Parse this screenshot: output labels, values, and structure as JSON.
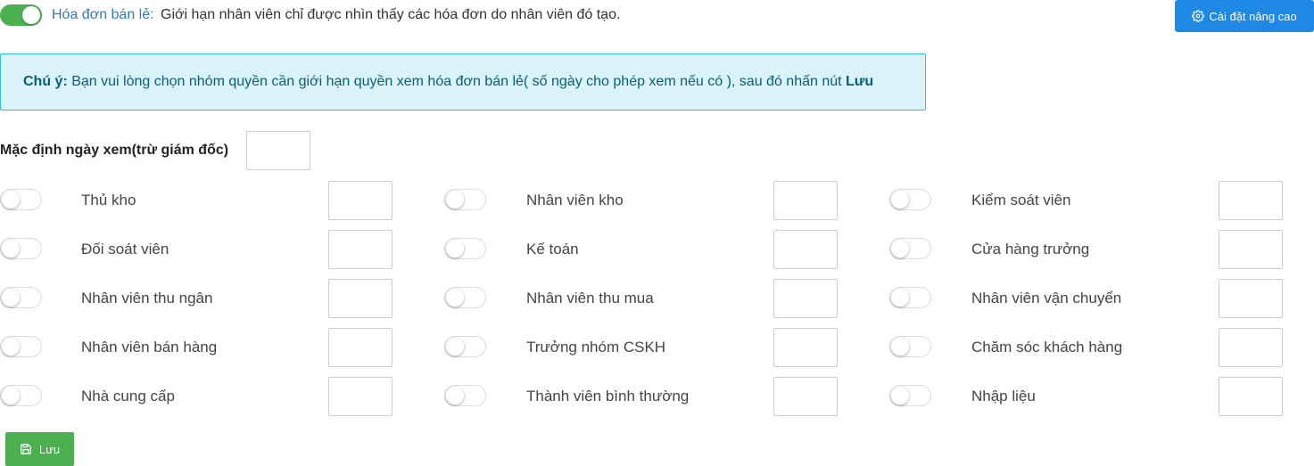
{
  "header": {
    "toggle_on": true,
    "title": "Hóa đơn bán lẻ:",
    "description": "Giới hạn nhân viên chỉ được nhìn thấy các hóa đơn do nhân viên đó tạo.",
    "advanced_button": "Cài đặt nâng cao"
  },
  "alert": {
    "prefix": "Chú ý:",
    "message": " Bạn vui lòng chọn nhóm quyền cần giới hạn quyền xem hóa đơn bán lẻ( số ngày cho phép xem nếu có ), sau đó nhấn nút ",
    "emphasis": "Lưu"
  },
  "default_days": {
    "label": "Mặc định ngày xem(trừ giám đốc)",
    "value": ""
  },
  "roles": [
    {
      "label": "Thủ kho",
      "enabled": false,
      "days": ""
    },
    {
      "label": "Nhân viên kho",
      "enabled": false,
      "days": ""
    },
    {
      "label": "Kiểm soát viên",
      "enabled": false,
      "days": ""
    },
    {
      "label": "Đối soát viên",
      "enabled": false,
      "days": ""
    },
    {
      "label": "Kế toán",
      "enabled": false,
      "days": ""
    },
    {
      "label": "Cửa hàng trưởng",
      "enabled": false,
      "days": ""
    },
    {
      "label": "Nhân viên thu ngân",
      "enabled": false,
      "days": ""
    },
    {
      "label": "Nhân viên thu mua",
      "enabled": false,
      "days": ""
    },
    {
      "label": "Nhân viên vận chuyển",
      "enabled": false,
      "days": ""
    },
    {
      "label": "Nhân viên bán hàng",
      "enabled": false,
      "days": ""
    },
    {
      "label": "Trưởng nhóm CSKH",
      "enabled": false,
      "days": ""
    },
    {
      "label": "Chăm sóc khách hàng",
      "enabled": false,
      "days": ""
    },
    {
      "label": "Nhà cung cấp",
      "enabled": false,
      "days": ""
    },
    {
      "label": "Thành viên bình thường",
      "enabled": false,
      "days": ""
    },
    {
      "label": "Nhập liệu",
      "enabled": false,
      "days": ""
    }
  ],
  "save_button": "Lưu",
  "icons": {
    "advanced": "gear-icon",
    "save": "floppy-disk-icon"
  },
  "colors": {
    "toggle_on": "#4caf50",
    "primary": "#1e88e5",
    "link": "#337ab7",
    "alert_bg": "#d9f3f8",
    "alert_border": "#30c1de",
    "success": "#4caf50"
  }
}
